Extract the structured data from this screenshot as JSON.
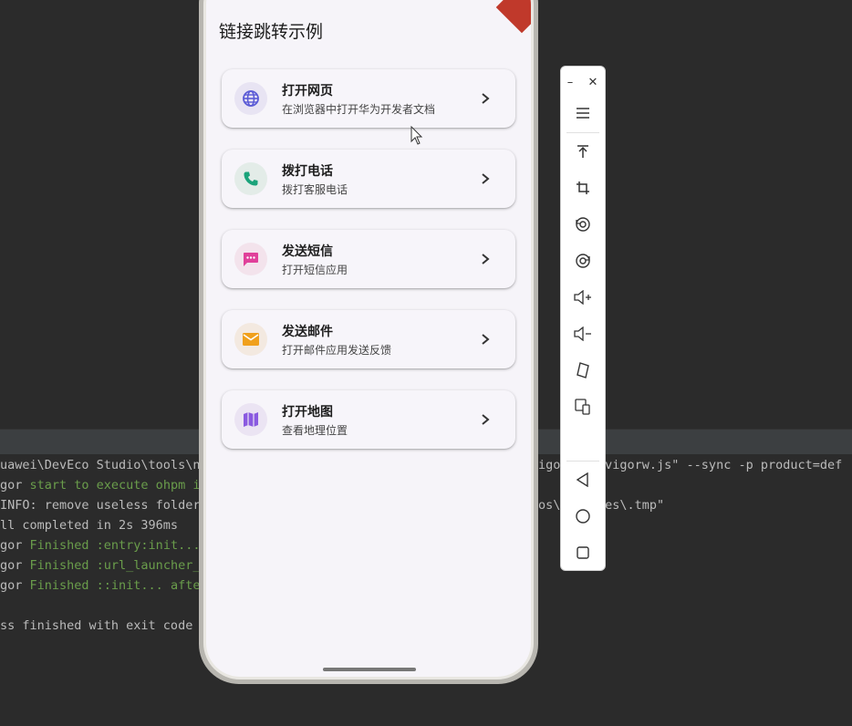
{
  "app": {
    "title": "链接跳转示例"
  },
  "cards": [
    {
      "title": "打开网页",
      "subtitle": "在浏览器中打开华为开发者文档",
      "icon": "globe-icon",
      "icon_color": "#5b5bd6",
      "bg": "#e8e4f3"
    },
    {
      "title": "拨打电话",
      "subtitle": "拨打客服电话",
      "icon": "phone-icon",
      "icon_color": "#1aa37a",
      "bg": "#e3ece8"
    },
    {
      "title": "发送短信",
      "subtitle": "打开短信应用",
      "icon": "message-icon",
      "icon_color": "#e0409a",
      "bg": "#f3e3ec"
    },
    {
      "title": "发送邮件",
      "subtitle": "打开邮件应用发送反馈",
      "icon": "mail-icon",
      "icon_color": "#f0a01c",
      "bg": "#f3e9e0"
    },
    {
      "title": "打开地图",
      "subtitle": "查看地理位置",
      "icon": "map-icon",
      "icon_color": "#8a5ae0",
      "bg": "#ebe4f3"
    }
  ],
  "console": [
    {
      "pre": "uawei\\DevEco Studio\\tools\\n",
      "green": "",
      "post": "",
      "tail": "igor    hvigorw.js\" --sync -p product=def"
    },
    {
      "pre": "gor ",
      "green": "start to execute ohpm in",
      "post": "",
      "tail": ""
    },
    {
      "pre": "INFO: remove useless folder",
      "green": "",
      "post": "",
      "tail": "os\\    ules\\.tmp\""
    },
    {
      "pre": "",
      "green": "ll completed in 2s 396ms",
      "post": "",
      "tail": ""
    },
    {
      "pre": "gor ",
      "green": "Finished :entry:init...",
      "post": "",
      "tail": ""
    },
    {
      "pre": "gor ",
      "green": "Finished :url_launcher_o",
      "post": "",
      "tail": ""
    },
    {
      "pre": "gor ",
      "green": "Finished ::init... after",
      "post": "",
      "tail": ""
    },
    {
      "pre": "",
      "green": "",
      "post": "",
      "tail": ""
    },
    {
      "pre": "ss finished with exit code ",
      "green": "",
      "post": "",
      "tail": ""
    }
  ],
  "toolbar": {
    "minimize": "–",
    "close": "✕"
  }
}
